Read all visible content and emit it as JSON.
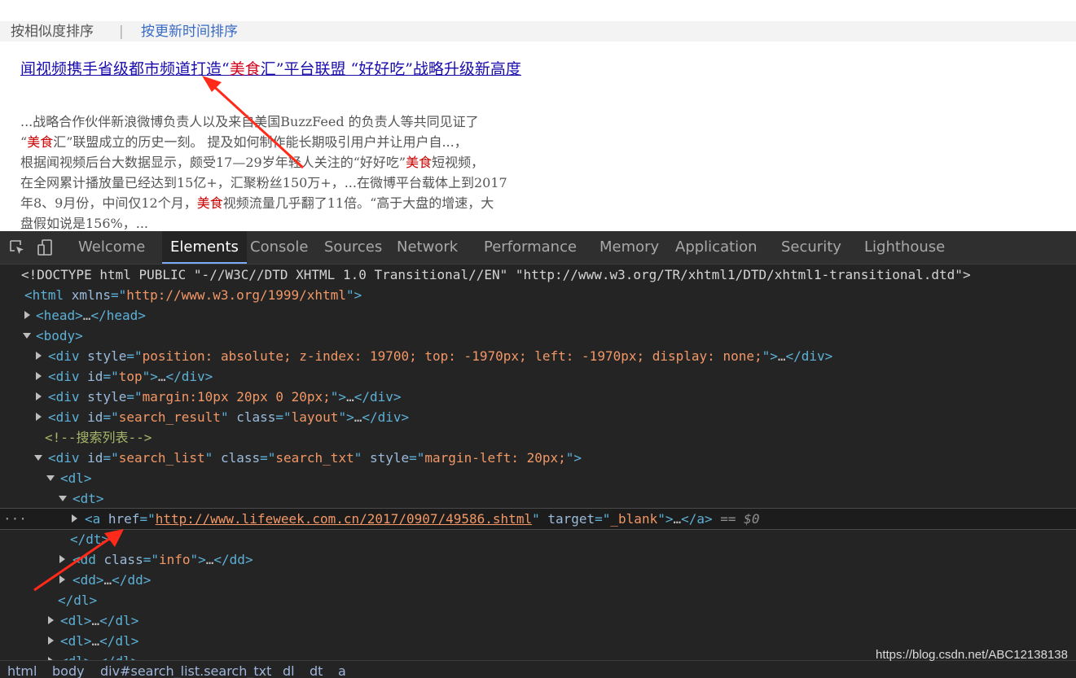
{
  "sort_bar": {
    "by_relevance": "按相似度排序",
    "separator": "|",
    "by_time": "按更新时间排序"
  },
  "result": {
    "title_part1": "闻视频携手省级都市频道打造“",
    "title_hl": "美食",
    "title_part2": "汇”平台联盟 “好好吃”战略升级新高度",
    "snippet": [
      "...战略合作伙伴新浪微博负责人以及来自美国BuzzFeed 的负责人等共同见证了",
      "“",
      "美食",
      "汇”联盟成立的历史一刻。 提及如何制作能长期吸引用户并让用户自...，",
      "根据闻视频后台大数据显示，颇受17—29岁年轻人关注的“好好吃”",
      "美食",
      "短视频，",
      "在全网累计播放量已经达到15亿+，汇聚粉丝150万+，...在微博平台载体上到2017",
      "年8、9月份，中间仅12个月，",
      "美食",
      "视频流量几乎翻了11倍。“高于大盘的增速，大",
      "盘假如说是156%，..."
    ]
  },
  "devtools": {
    "tabs": [
      "Welcome",
      "Elements",
      "Console",
      "Sources",
      "Network",
      "Performance",
      "Memory",
      "Application",
      "Security",
      "Lighthouse"
    ],
    "active_tab": "Elements",
    "doctype": "<!DOCTYPE html PUBLIC \"-//W3C//DTD XHTML 1.0 Transitional//EN\" \"http://www.w3.org/TR/xhtml1/DTD/xhtml1-transitional.dtd\">",
    "html_xmlns": "http://www.w3.org/1999/xhtml",
    "div1_style": "position: absolute; z-index: 19700; top: -1970px; left: -1970px; display: none;",
    "div2_id": "top",
    "div3_style": "margin:10px 20px 0 20px;",
    "div4_id": "search_result",
    "div4_class": "layout",
    "comment": "<!--搜索列表-->",
    "div5_id": "search_list",
    "div5_class": "search_txt",
    "div5_style": "margin-left: 20px;",
    "a_href": "http://www.lifeweek.com.cn/2017/0907/49586.shtml",
    "a_target": "_blank",
    "selected_marker": "== $0",
    "dd_class": "info",
    "row_dots": "···",
    "breadcrumbs": [
      "html",
      "body",
      "div#search_list.search_txt",
      "dl",
      "dt",
      "a"
    ]
  },
  "watermark": "https://blog.csdn.net/ABC12138138",
  "colors": {
    "annotation_arrow": "#ff2a1a",
    "devtools_bg": "#242424",
    "link_blue": "#1a0dab"
  }
}
